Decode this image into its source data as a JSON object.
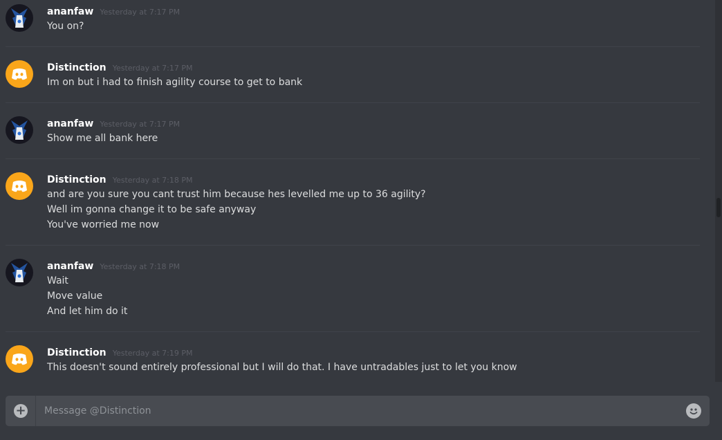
{
  "conversation": {
    "messages": [
      {
        "author": "ananfaw",
        "avatar": "runescape",
        "timestamp": "Yesterday at 7:17 PM",
        "lines": [
          "You on?"
        ]
      },
      {
        "author": "Distinction",
        "avatar": "discord",
        "timestamp": "Yesterday at 7:17 PM",
        "lines": [
          "Im on but i had to finish agility course to get to bank"
        ]
      },
      {
        "author": "ananfaw",
        "avatar": "runescape",
        "timestamp": "Yesterday at 7:17 PM",
        "lines": [
          "Show me all bank here"
        ]
      },
      {
        "author": "Distinction",
        "avatar": "discord",
        "timestamp": "Yesterday at 7:18 PM",
        "lines": [
          "and are you sure you cant trust him because hes levelled me up to 36 agility?",
          "Well im gonna change it to be safe anyway",
          "You've worried me now"
        ]
      },
      {
        "author": "ananfaw",
        "avatar": "runescape",
        "timestamp": "Yesterday at 7:18 PM",
        "lines": [
          "Wait",
          "Move value",
          "And let him do it"
        ]
      },
      {
        "author": "Distinction",
        "avatar": "discord",
        "timestamp": "Yesterday at 7:19 PM",
        "lines": [
          "This doesn't sound entirely professional but I will do that. I have untradables just to let you know"
        ]
      }
    ]
  },
  "composer": {
    "placeholder": "Message @Distinction",
    "upload_icon": "plus-icon",
    "emoji_icon": "emoji-icon"
  },
  "colors": {
    "background": "#36393f",
    "composer": "#484b51",
    "discord_avatar": "#faa61a"
  }
}
